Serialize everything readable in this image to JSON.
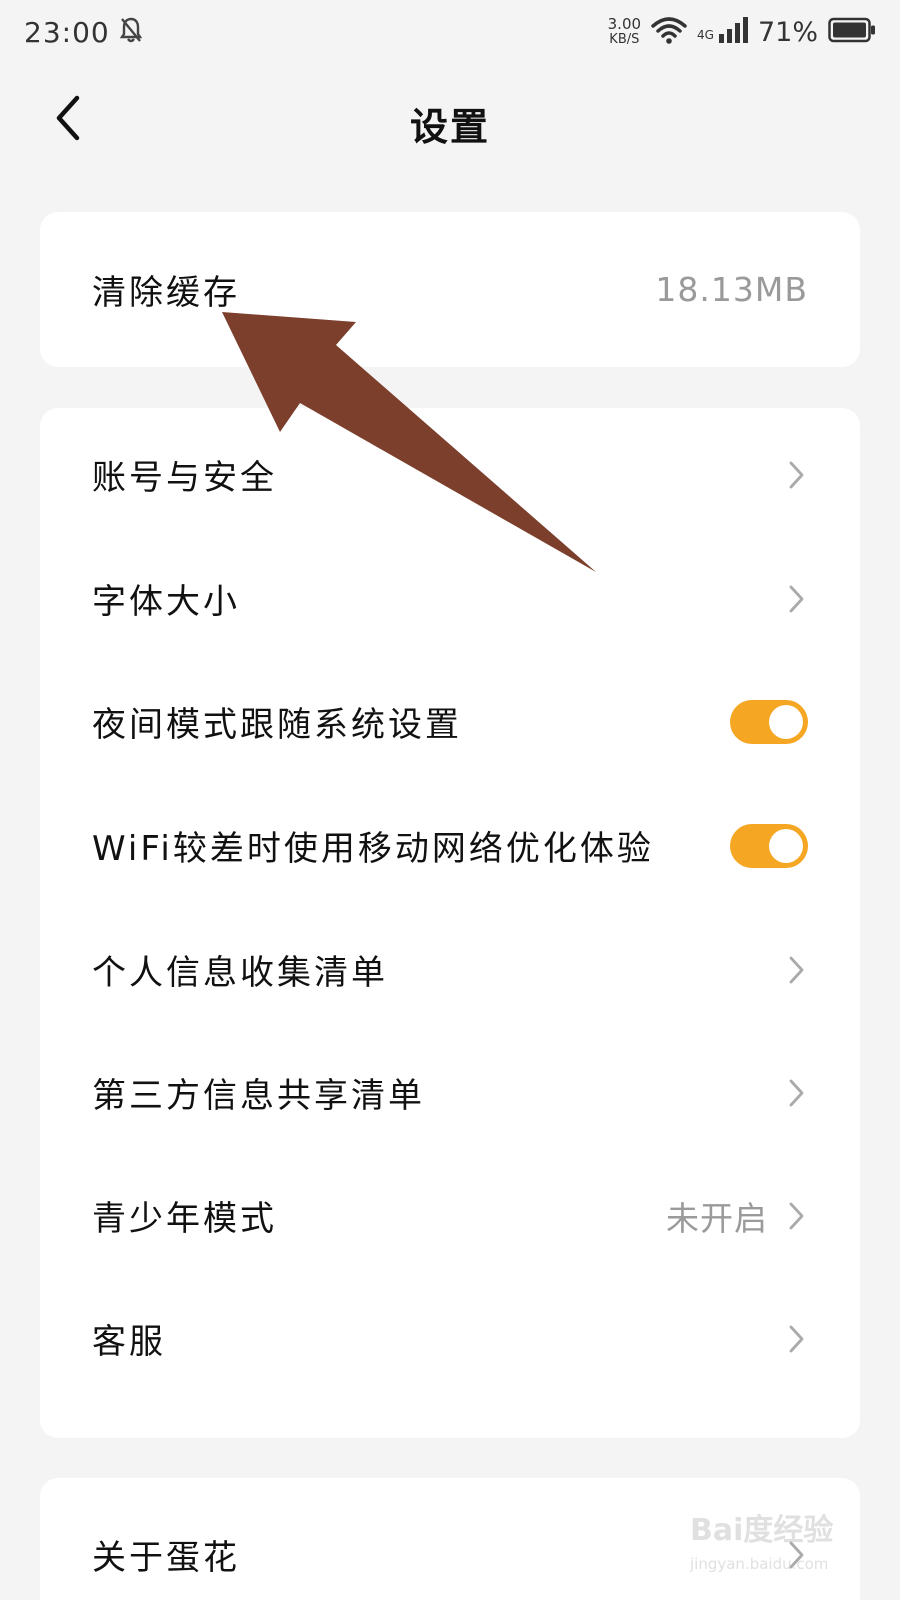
{
  "status_bar": {
    "time": "23:00",
    "speed_value": "3.00",
    "speed_unit": "KB/S",
    "network": "4G",
    "battery": "71%"
  },
  "header": {
    "title": "设置"
  },
  "cache": {
    "label": "清除缓存",
    "value": "18.13MB"
  },
  "settings": {
    "items": [
      {
        "label": "账号与安全",
        "type": "chevron"
      },
      {
        "label": "字体大小",
        "type": "chevron"
      },
      {
        "label": "夜间模式跟随系统设置",
        "type": "toggle",
        "on": true
      },
      {
        "label": "WiFi较差时使用移动网络优化体验",
        "type": "toggle",
        "on": true
      },
      {
        "label": "个人信息收集清单",
        "type": "chevron"
      },
      {
        "label": "第三方信息共享清单",
        "type": "chevron"
      },
      {
        "label": "青少年模式",
        "type": "chevron",
        "value": "未开启"
      },
      {
        "label": "客服",
        "type": "chevron"
      }
    ]
  },
  "about": {
    "label": "关于蛋花"
  },
  "watermark": {
    "brand": "Bai度经验",
    "url": "jingyan.baidu.com"
  },
  "colors": {
    "accent": "#f5a623",
    "annotation_arrow": "#7b3f2c",
    "background": "#f4f4f4",
    "card": "#ffffff",
    "secondary_text": "#9a9a9a"
  }
}
